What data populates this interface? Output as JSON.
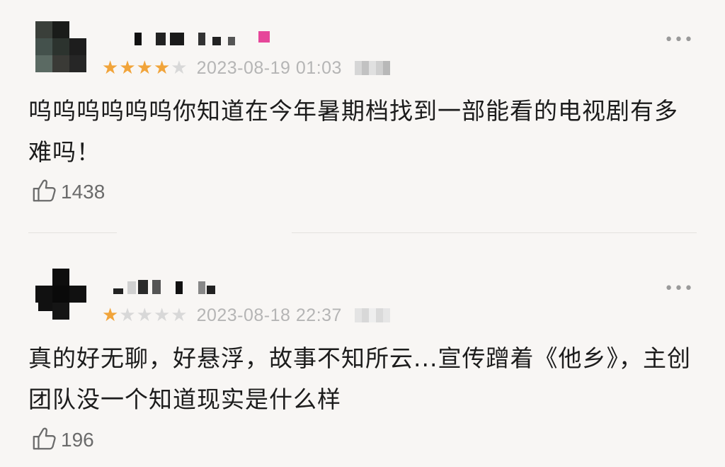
{
  "reviews": [
    {
      "rating": 4,
      "max_rating": 5,
      "date": "2023-08-19 01:03",
      "text": "呜呜呜呜呜呜你知道在今年暑期档找到一部能看的电视剧有多难吗！",
      "likes": "1438",
      "more_label": "•••"
    },
    {
      "rating": 1,
      "max_rating": 5,
      "date": "2023-08-18 22:37",
      "text": "真的好无聊，好悬浮，故事不知所云...宣传蹭着《他乡》，主创团队没一个知道现实是什么样",
      "likes": "196",
      "more_label": "•••"
    }
  ],
  "colors": {
    "star_on": "#f1a43a",
    "star_off": "#d8d8d8",
    "date": "#b5b5b5",
    "likes": "#6b6b6b",
    "background": "#f8f6f4"
  },
  "icons": {
    "like": "thumbs-up-icon",
    "more": "more-dots-icon",
    "star": "star-icon"
  }
}
